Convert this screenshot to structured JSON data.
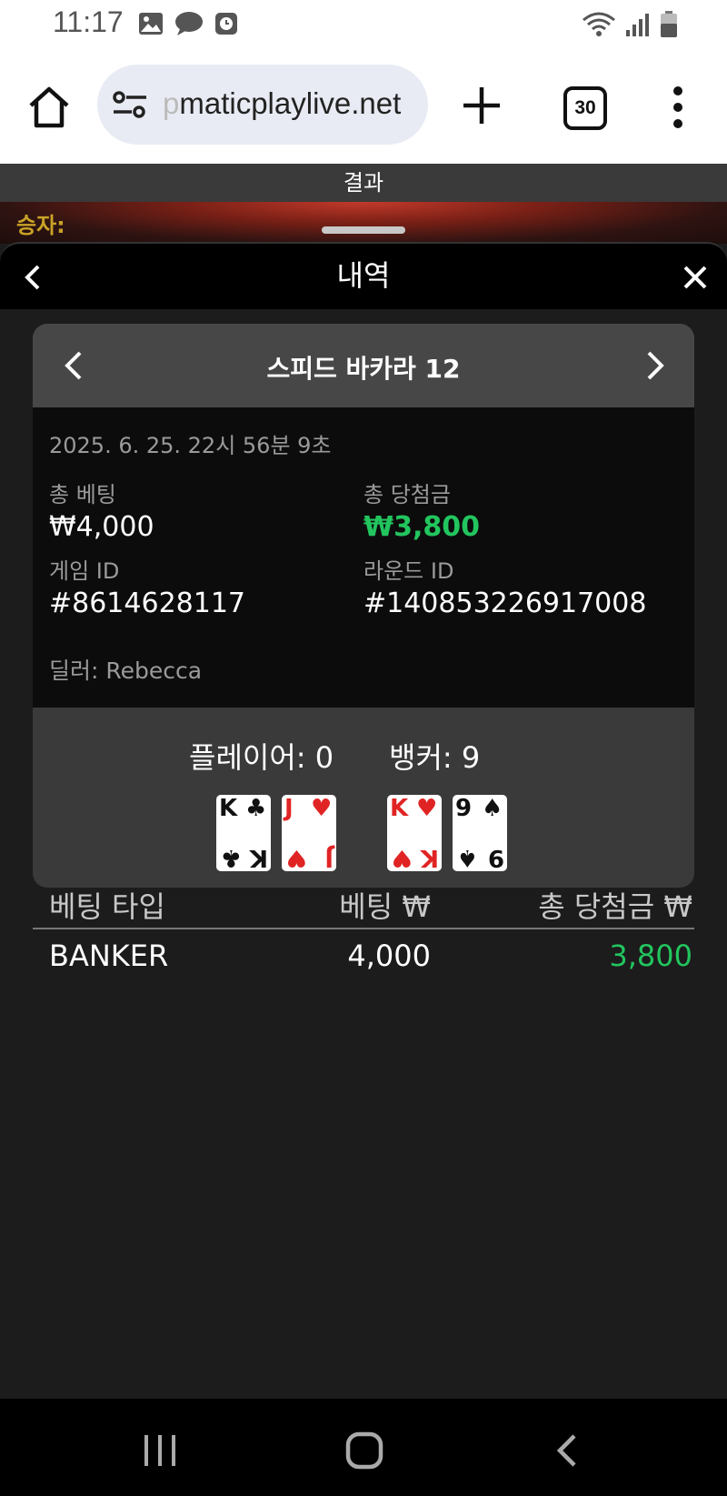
{
  "status_bar": {
    "time": "11:17"
  },
  "browser": {
    "url_fade": "p",
    "url_main": "maticplaylive.net",
    "tab_count": "30"
  },
  "game": {
    "result_label": "결과",
    "winner_label": "승자:"
  },
  "sheet": {
    "title": "내역"
  },
  "detail": {
    "game_name": "스피드 바카라 12",
    "timestamp": "2025. 6. 25. 22시 56분 9초",
    "total_bet_label": "총 베팅",
    "total_bet_value": "₩4,000",
    "total_win_label": "총 당첨금",
    "total_win_value": "₩3,800",
    "game_id_label": "게임 ID",
    "game_id_value": "#8614628117",
    "round_id_label": "라운드 ID",
    "round_id_value": "#140853226917008",
    "dealer": "딜러: Rebecca",
    "player_score": "플레이어: 0",
    "banker_score": "뱅커: 9",
    "player_cards": [
      {
        "rank": "K",
        "suit": "♣",
        "color": "black"
      },
      {
        "rank": "J",
        "suit": "♥",
        "color": "red"
      }
    ],
    "banker_cards": [
      {
        "rank": "K",
        "suit": "♥",
        "color": "red"
      },
      {
        "rank": "9",
        "suit": "♠",
        "color": "black"
      }
    ]
  },
  "bets": {
    "headers": [
      "베팅 타입",
      "베팅 ₩",
      "총 당첨금 ₩"
    ],
    "rows": [
      {
        "type": "BANKER",
        "bet": "4,000",
        "win": "3,800"
      }
    ]
  },
  "colors": {
    "win_green": "#22c55e",
    "winner_gold": "#c9a227"
  }
}
